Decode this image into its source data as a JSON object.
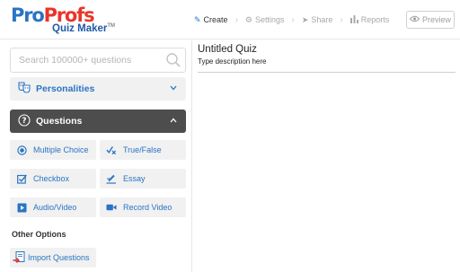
{
  "brand": {
    "logo_pro": "Pro",
    "logo_profs": "Profs",
    "logo_sub": "Quiz Maker",
    "trademark": "TM",
    "colors": {
      "blue": "#2a74c4",
      "red": "#e8352a",
      "dark": "#4d4d4d"
    }
  },
  "nav": {
    "steps": [
      {
        "label": "Create",
        "icon": "pencil-icon",
        "active": true
      },
      {
        "label": "Settings",
        "icon": "gear-icon",
        "active": false
      },
      {
        "label": "Share",
        "icon": "paper-plane-icon",
        "active": false
      },
      {
        "label": "Reports",
        "icon": "bar-chart-icon",
        "active": false
      }
    ],
    "preview_label": "Preview"
  },
  "sidebar": {
    "search_placeholder": "Search 100000+ questions",
    "personalities_label": "Personalities",
    "questions_label": "Questions",
    "question_types": [
      {
        "label": "Multiple Choice",
        "icon": "radio-icon"
      },
      {
        "label": "True/False",
        "icon": "check-cross-icon"
      },
      {
        "label": "Checkbox",
        "icon": "checkbox-icon"
      },
      {
        "label": "Essay",
        "icon": "essay-pen-icon"
      },
      {
        "label": "Audio/Video",
        "icon": "play-icon"
      },
      {
        "label": "Record Video",
        "icon": "video-camera-icon"
      }
    ],
    "other_options_label": "Other Options",
    "import_label": "Import Questions"
  },
  "main": {
    "quiz_title": "Untitled Quiz",
    "quiz_description": "Type description here"
  }
}
